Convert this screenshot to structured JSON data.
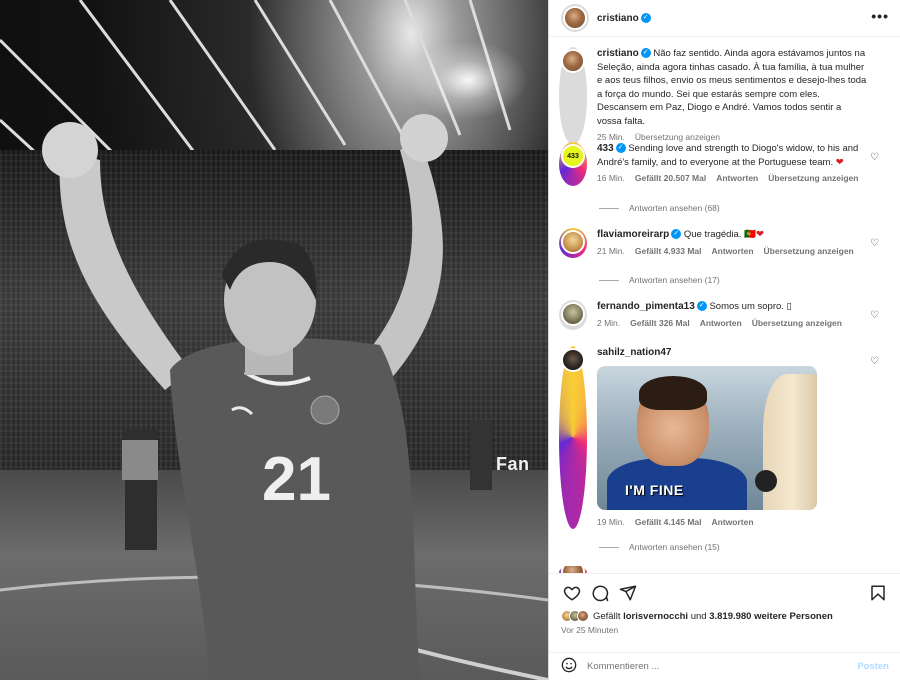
{
  "photo": {
    "jersey_number": "21",
    "board_text": "Fan"
  },
  "header": {
    "username": "cristiano",
    "more_icon": "more-horizontal-icon"
  },
  "caption": {
    "username": "cristiano",
    "text": "Não faz sentido. Ainda agora estávamos juntos na Seleção, ainda agora tinhas casado. À tua família, à tua mulher e aos teus filhos, envio os meus sentimentos e desejo-lhes toda a força do mundo. Sei que estarás sempre com eles. Descansem em Paz, Diogo e André. Vamos todos sentir a vossa falta.",
    "time": "25 Min.",
    "translate": "Übersetzung anzeigen"
  },
  "comments": [
    {
      "username": "433",
      "verified": true,
      "text": "Sending love and strength to Diogo's widow, to his and André's family, and to everyone at the Portuguese team.",
      "emoji": "❤",
      "time": "16 Min.",
      "likes": "Gefällt 20.507 Mal",
      "reply": "Antworten",
      "translate": "Übersetzung anzeigen",
      "view_replies": "Antworten ansehen (68)"
    },
    {
      "username": "flaviamoreirarp",
      "verified": true,
      "text": "Que tragédia.",
      "emoji": "🇵🇹❤",
      "time": "21 Min.",
      "likes": "Gefällt 4.933 Mal",
      "reply": "Antworten",
      "translate": "Übersetzung anzeigen",
      "view_replies": "Antworten ansehen (17)"
    },
    {
      "username": "fernando_pimenta13",
      "verified": true,
      "text": "Somos um sopro. ▯",
      "time": "2 Min.",
      "likes": "Gefällt 326 Mal",
      "reply": "Antworten",
      "translate": "Übersetzung anzeigen"
    },
    {
      "username": "sahilz_nation47",
      "verified": false,
      "gif_caption": "I'M FINE",
      "time": "19 Min.",
      "likes": "Gefällt 4.145 Mal",
      "reply": "Antworten",
      "view_replies": "Antworten ansehen (15)"
    }
  ],
  "actions": {
    "like_icon": "heart-icon",
    "comment_icon": "comment-bubble-icon",
    "share_icon": "paper-plane-icon",
    "save_icon": "bookmark-icon",
    "likes_prefix": "Gefällt",
    "likes_user": "lorisvernocchi",
    "likes_mid": "und",
    "likes_count": "3.819.980 weitere Personen",
    "posted_ago": "Vor 25 Minuten"
  },
  "composer": {
    "emoji_icon": "smiley-icon",
    "placeholder": "Kommentieren ...",
    "post_label": "Posten"
  },
  "colors": {
    "link_blue": "#0095f6",
    "post_disabled": "#b3dbff",
    "heart_red": "#d61f26",
    "meta_grey": "#737373"
  }
}
